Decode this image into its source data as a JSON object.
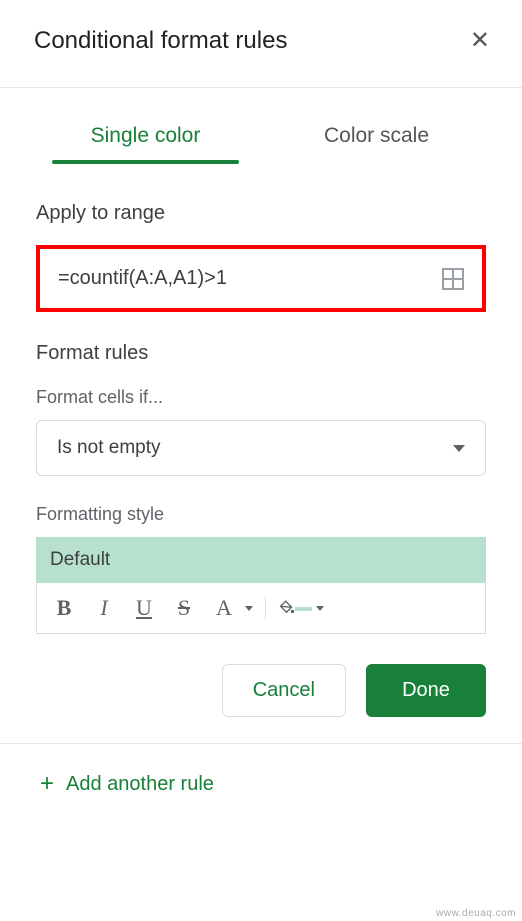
{
  "header": {
    "title": "Conditional format rules"
  },
  "tabs": {
    "single": "Single color",
    "scale": "Color scale"
  },
  "range": {
    "label": "Apply to range",
    "value": "=countif(A:A,A1)>1"
  },
  "rules": {
    "heading": "Format rules",
    "format_if_label": "Format cells if...",
    "format_if_value": "Is not empty"
  },
  "style": {
    "label": "Formatting style",
    "preview": "Default",
    "bold": "B",
    "italic": "I",
    "underline": "U",
    "strike": "S",
    "textcolor": "A"
  },
  "actions": {
    "cancel": "Cancel",
    "done": "Done"
  },
  "footer": {
    "add_rule": "Add another rule"
  },
  "colors": {
    "accent": "#188038",
    "highlight": "#b7e1cd"
  },
  "watermark": "www.deuaq.com"
}
